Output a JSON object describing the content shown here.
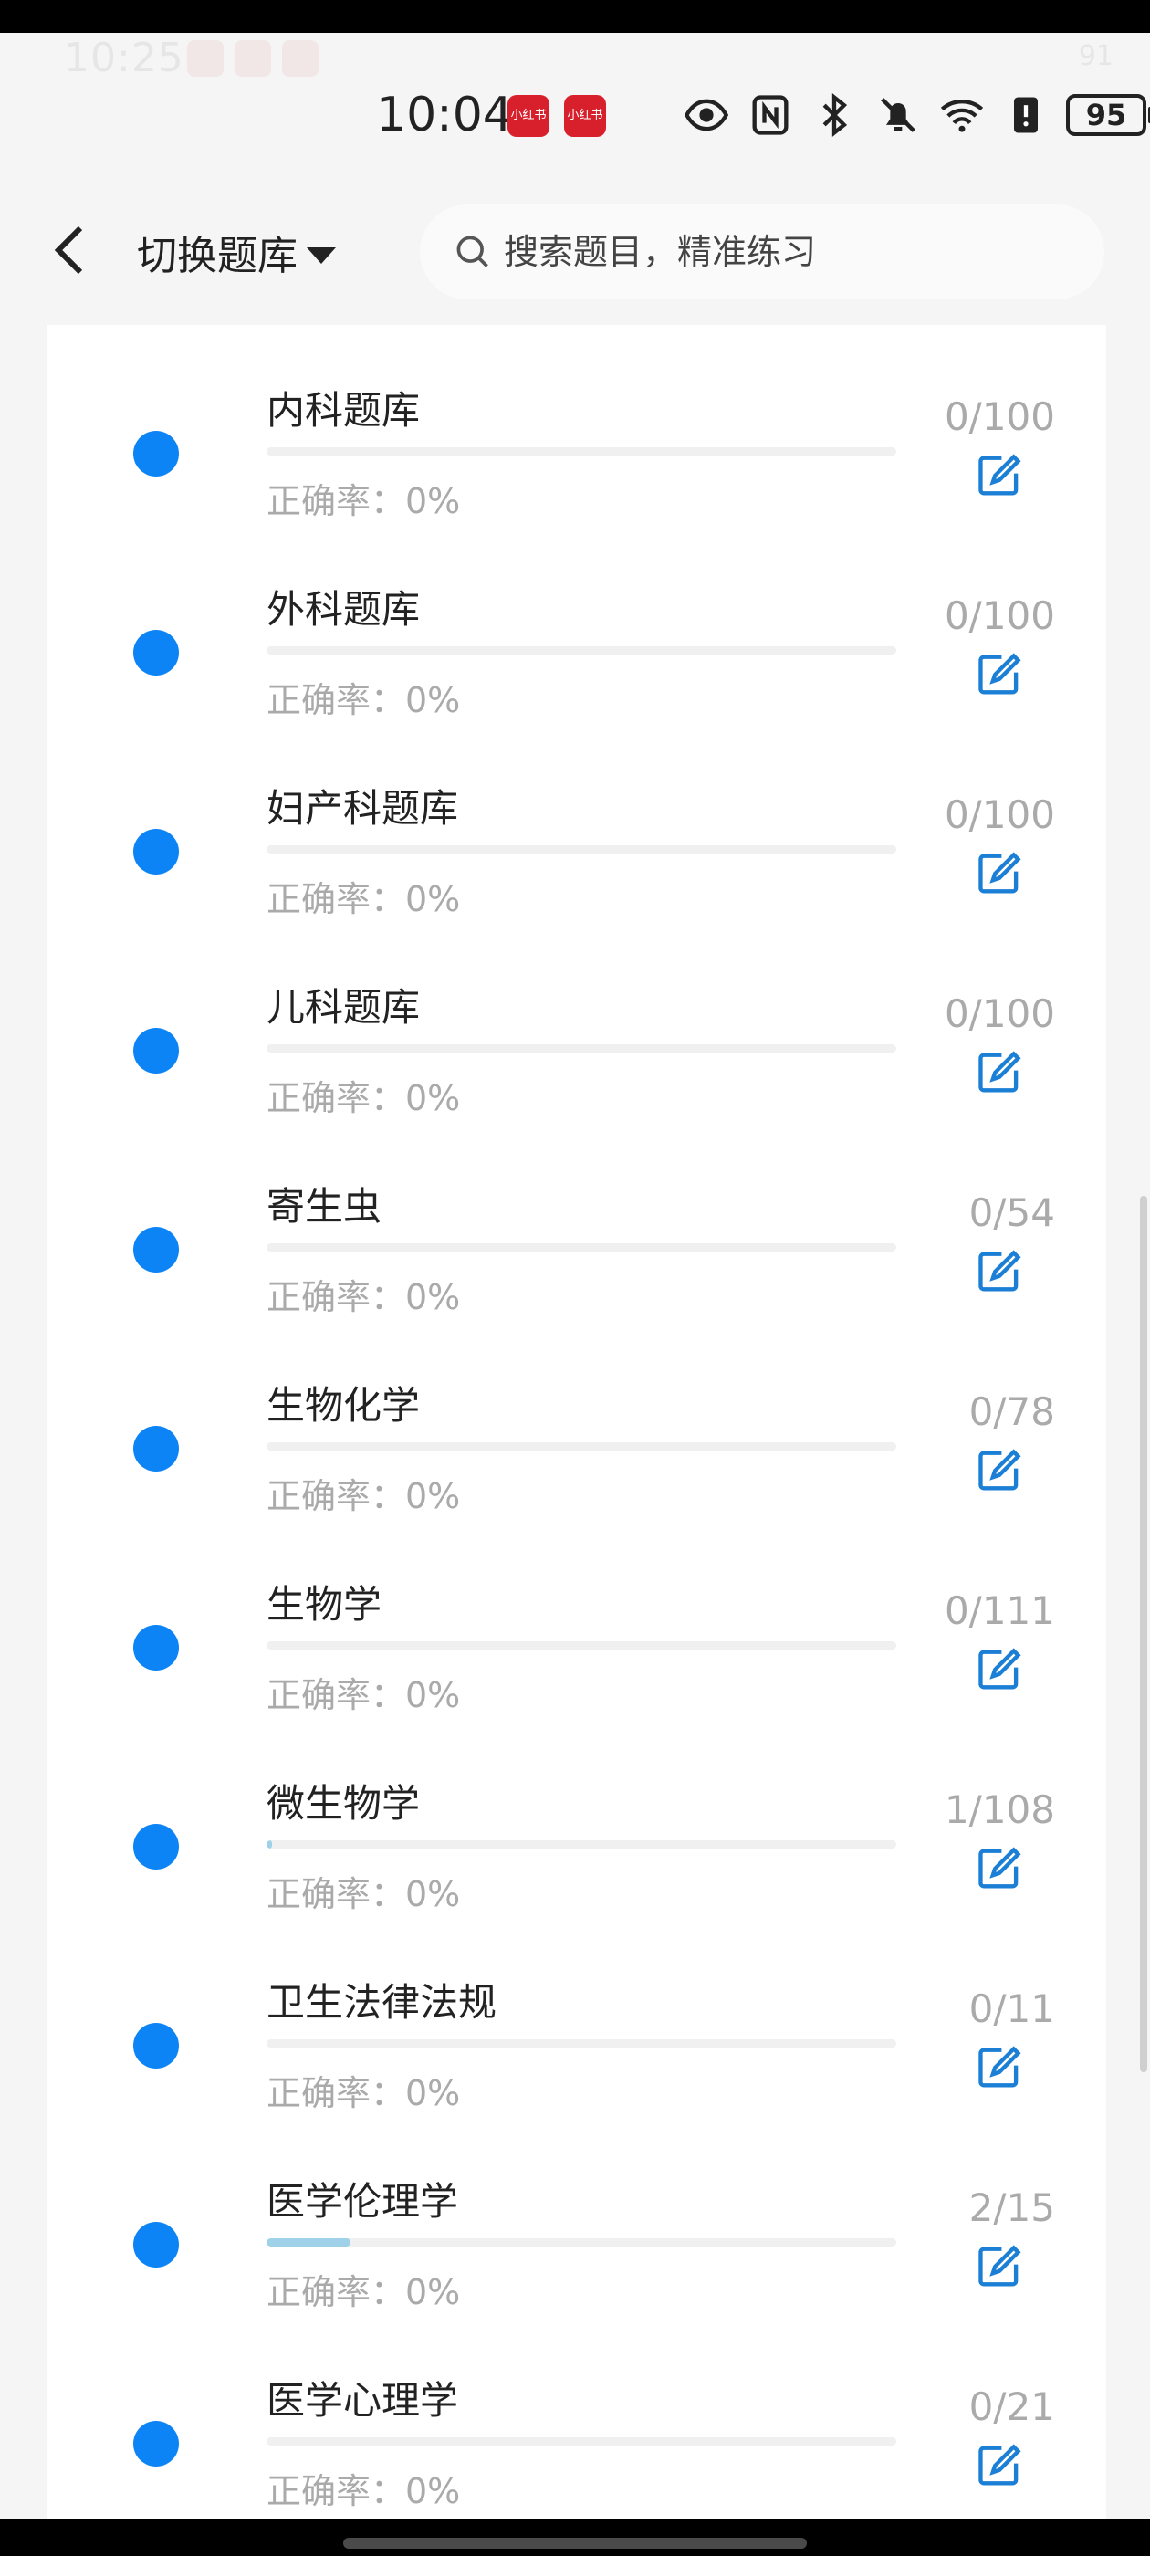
{
  "ghost_status": {
    "time": "10:25",
    "battery": "91"
  },
  "status_bar": {
    "time": "10:04",
    "battery": "95",
    "apps": [
      "小红书",
      "小红书"
    ]
  },
  "header": {
    "title": "切换题库",
    "search_placeholder": "搜索题目，精准练习"
  },
  "items": [
    {
      "name": "内科题库",
      "accuracy_label": "正确率：0%",
      "count": "0/100",
      "progress": 0
    },
    {
      "name": "外科题库",
      "accuracy_label": "正确率：0%",
      "count": "0/100",
      "progress": 0
    },
    {
      "name": "妇产科题库",
      "accuracy_label": "正确率：0%",
      "count": "0/100",
      "progress": 0
    },
    {
      "name": "儿科题库",
      "accuracy_label": "正确率：0%",
      "count": "0/100",
      "progress": 0
    },
    {
      "name": "寄生虫",
      "accuracy_label": "正确率：0%",
      "count": "0/54",
      "progress": 0
    },
    {
      "name": "生物化学",
      "accuracy_label": "正确率：0%",
      "count": "0/78",
      "progress": 0
    },
    {
      "name": "生物学",
      "accuracy_label": "正确率：0%",
      "count": "0/111",
      "progress": 0
    },
    {
      "name": "微生物学",
      "accuracy_label": "正确率：0%",
      "count": "1/108",
      "progress": 0.0093
    },
    {
      "name": "卫生法律法规",
      "accuracy_label": "正确率：0%",
      "count": "0/11",
      "progress": 0
    },
    {
      "name": "医学伦理学",
      "accuracy_label": "正确率：0%",
      "count": "2/15",
      "progress": 0.1333
    },
    {
      "name": "医学心理学",
      "accuracy_label": "正确率：0%",
      "count": "0/21",
      "progress": 0
    }
  ],
  "colors": {
    "dot": "#0d84f5",
    "progress": "#9fd2e8",
    "edit_icon": "#1c7fd6"
  }
}
